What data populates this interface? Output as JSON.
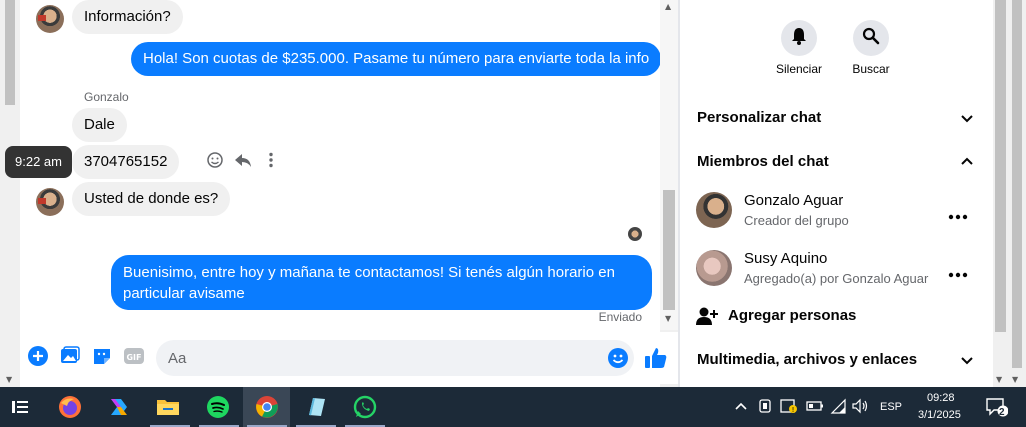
{
  "chat": {
    "messages": [
      {
        "dir": "in",
        "text": "Información?"
      },
      {
        "dir": "out",
        "text": "Hola! Son cuotas de $235.000. Pasame tu número para enviarte toda la info"
      },
      {
        "dir": "in",
        "sender": "Gonzalo",
        "text": "Dale"
      },
      {
        "dir": "in",
        "text": "3704765152",
        "tooltip": "9:22 am"
      },
      {
        "dir": "in",
        "text": "Usted de donde es?"
      },
      {
        "dir": "out",
        "text_line1": "Buenisimo, entre hoy y mañana te contactamos! Si tenés algún horario en",
        "text_line2": "particular avisame"
      }
    ],
    "status": "Enviado"
  },
  "composer": {
    "placeholder": "Aa"
  },
  "panel": {
    "actions": [
      {
        "label": "Silenciar",
        "icon": "bell-icon"
      },
      {
        "label": "Buscar",
        "icon": "search-icon"
      }
    ],
    "sections": {
      "customize": "Personalizar chat",
      "members": "Miembros del chat",
      "media": "Multimedia, archivos y enlaces"
    },
    "members": [
      {
        "name": "Gonzalo Aguar",
        "sub": "Creador del grupo"
      },
      {
        "name": "Susy Aquino",
        "sub": "Agregado(a) por Gonzalo Aguar"
      }
    ],
    "add_people": "Agregar personas"
  },
  "taskbar": {
    "language": "ESP",
    "time": "09:28",
    "date": "3/1/2025",
    "notifications": "2"
  },
  "colors": {
    "accent": "#0a7cff",
    "incoming": "#f0f0f0",
    "taskbar": "#1c2a38"
  }
}
